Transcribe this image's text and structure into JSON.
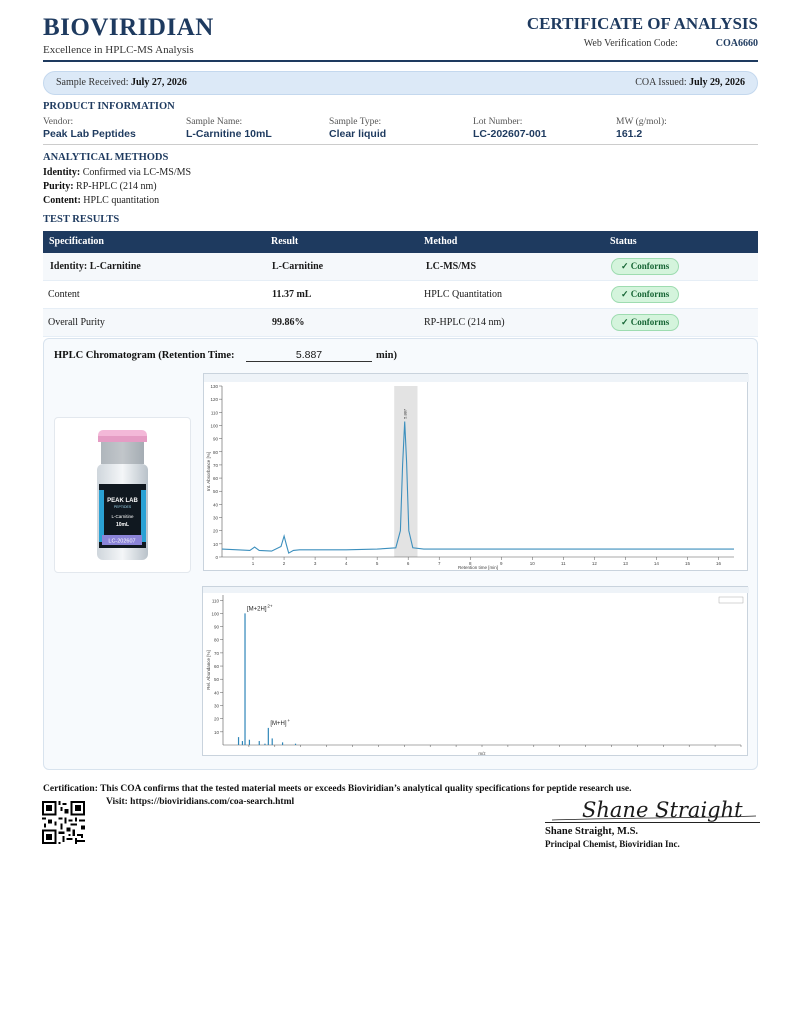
{
  "header": {
    "brand": "BIOVIRIDIAN",
    "tagline": "Excellence in HPLC-MS Analysis",
    "doc_title": "CERTIFICATE OF ANALYSIS",
    "verification_label": "Web Verification Code:",
    "verification_code": "COA6660"
  },
  "dates": {
    "received_label": "Sample Received:",
    "received_value": "July 27, 2026",
    "issued_label": "COA Issued:",
    "issued_value": "July 29, 2026"
  },
  "product": {
    "section_title": "PRODUCT INFORMATION",
    "fields": [
      {
        "label": "Vendor:",
        "value": "Peak Lab Peptides"
      },
      {
        "label": "Sample Name:",
        "value": "L-Carnitine 10mL"
      },
      {
        "label": "Sample Type:",
        "value": "Clear liquid"
      },
      {
        "label": "Lot Number:",
        "value": "LC-202607-001"
      },
      {
        "label": "MW (g/mol):",
        "value": "161.2"
      }
    ]
  },
  "methods": {
    "section_title": "ANALYTICAL METHODS",
    "lines": [
      {
        "label": "Identity:",
        "value": "Confirmed via LC-MS/MS"
      },
      {
        "label": "Purity:",
        "value": "RP-HPLC (214 nm)"
      },
      {
        "label": "Content:",
        "value": "HPLC quantitation"
      }
    ]
  },
  "results": {
    "section_title": "TEST RESULTS",
    "headers": [
      "Specification",
      "Result",
      "Method",
      "Status"
    ],
    "rows": [
      {
        "spec": "Identity:  L-Carnitine",
        "result": "L-Carnitine",
        "method": "LC-MS/MS",
        "status": "✓ Conforms"
      },
      {
        "spec": "Content",
        "result": "11.37   mL",
        "method": "HPLC Quantitation",
        "status": "✓ Conforms"
      },
      {
        "spec": "Overall Purity",
        "result": "99.86%",
        "method": "RP-HPLC (214 nm)",
        "status": "✓ Conforms"
      }
    ]
  },
  "chromatogram": {
    "title": "HPLC Chromatogram (Retention Time:",
    "retention_time": "5.887",
    "unit": "min)"
  },
  "vial": {
    "brand": "PEAK LAB",
    "subbrand": "PEPTIDES",
    "product": "L-Carnitine",
    "volume": "10mL",
    "code": "LC-202607"
  },
  "chart_data": [
    {
      "type": "line",
      "title": "",
      "xlabel": "Retention time [min]",
      "ylabel": "Int. Absorbance [%]",
      "xlim": [
        0,
        16.5
      ],
      "ylim": [
        0,
        130
      ],
      "x_ticks": [
        1,
        2,
        3,
        4,
        5,
        6,
        7,
        8,
        9,
        10,
        11,
        12,
        13,
        14,
        15,
        16
      ],
      "y_ticks": [
        0,
        10,
        20,
        30,
        40,
        50,
        60,
        70,
        80,
        90,
        100,
        110,
        120,
        130
      ],
      "highlight_band": [
        5.55,
        6.3
      ],
      "x": [
        0,
        0.5,
        0.9,
        1.05,
        1.2,
        1.6,
        1.9,
        2.0,
        2.08,
        2.15,
        2.3,
        2.5,
        3,
        4,
        5,
        5.6,
        5.75,
        5.82,
        5.887,
        5.95,
        6.02,
        6.15,
        6.5,
        8,
        10,
        12,
        14,
        16,
        16.5
      ],
      "y": [
        6,
        5.5,
        5,
        7.5,
        5,
        4.5,
        8,
        16,
        9,
        3,
        5,
        5.5,
        5.5,
        5.5,
        6,
        7,
        20,
        70,
        103,
        72,
        20,
        7,
        6,
        6,
        6,
        6,
        6,
        6,
        6
      ],
      "peak_label": "5.887"
    },
    {
      "type": "bar",
      "title": "",
      "xlabel": "m/z",
      "ylabel": "Rel. Abundance [%]",
      "xlim": [
        0,
        2000
      ],
      "ylim": [
        0,
        114
      ],
      "y_ticks": [
        10,
        20,
        30,
        40,
        50,
        60,
        70,
        80,
        90,
        100,
        110
      ],
      "x": [
        60,
        75,
        85,
        102,
        140,
        162,
        175,
        190,
        230,
        280
      ],
      "values": [
        6,
        3,
        100,
        4,
        3,
        1,
        13,
        5,
        2,
        1
      ],
      "annotations": [
        {
          "x": 85,
          "y": 100,
          "text": "[M+2H]",
          "sup": "2+"
        },
        {
          "x": 175,
          "y": 13,
          "text": "[M+H]",
          "sup": "+"
        }
      ]
    }
  ],
  "footer": {
    "certification": "Certification: This COA confirms that the tested material meets or exceeds Bioviridian’s analytical quality specifications for peptide research use.",
    "visit": "Visit: https://bioviridians.com/coa-search.html",
    "signature": "Shane Straight",
    "signer_name": "Shane Straight, M.S.",
    "signer_title": "Principal Chemist, Bioviridian Inc."
  },
  "colors": {
    "navy": "#1e3a5f",
    "trace": "#3c8fbd",
    "conform_bg": "#d4f4dc",
    "conform_text": "#166534"
  }
}
